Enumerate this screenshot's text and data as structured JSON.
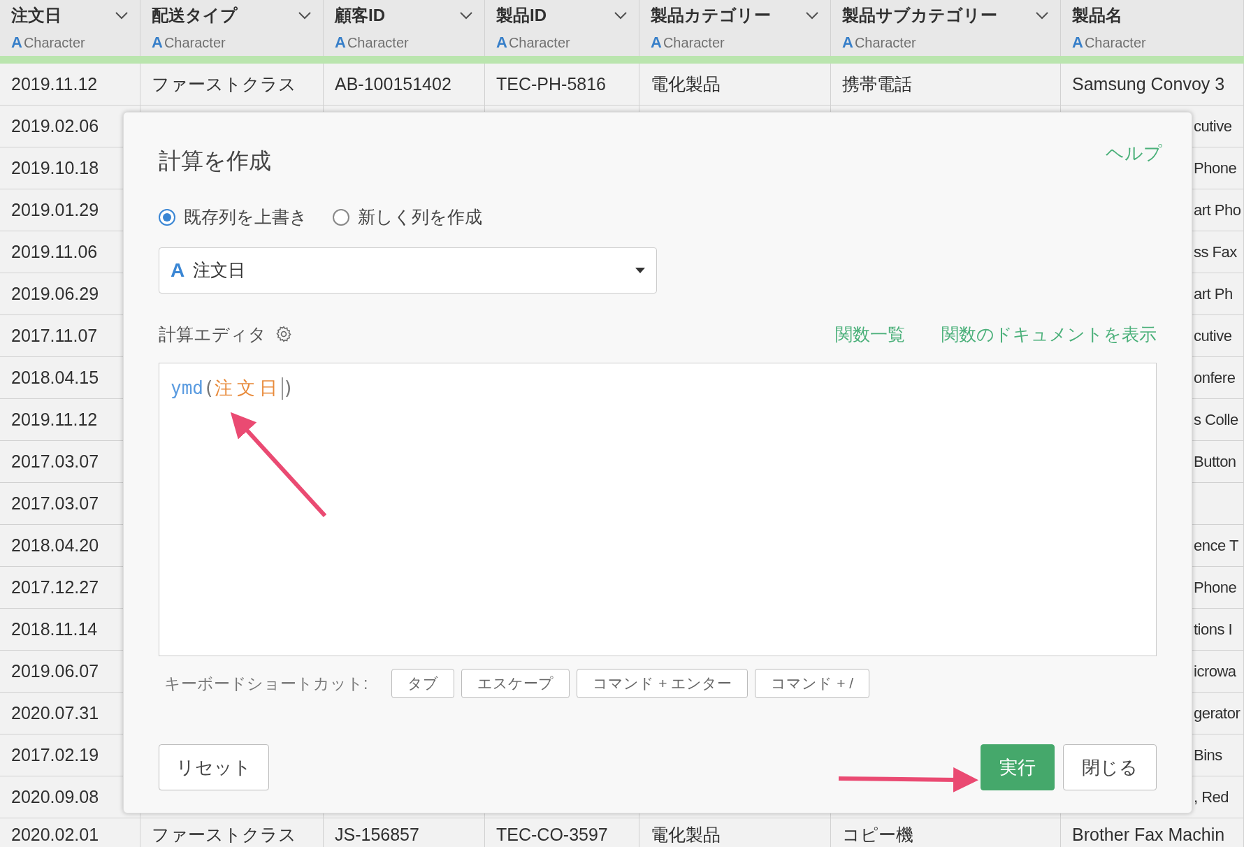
{
  "table": {
    "columns": [
      {
        "name": "注文日",
        "type_icon": "A",
        "type": "Character"
      },
      {
        "name": "配送タイプ",
        "type_icon": "A",
        "type": "Character"
      },
      {
        "name": "顧客ID",
        "type_icon": "A",
        "type": "Character"
      },
      {
        "name": "製品ID",
        "type_icon": "A",
        "type": "Character"
      },
      {
        "name": "製品カテゴリー",
        "type_icon": "A",
        "type": "Character"
      },
      {
        "name": "製品サブカテゴリー",
        "type_icon": "A",
        "type": "Character"
      },
      {
        "name": "製品名",
        "type_icon": "A",
        "type": "Character"
      }
    ],
    "rows": [
      {
        "cells": [
          "2019.11.12",
          "ファーストクラス",
          "AB-100151402",
          "TEC-PH-5816",
          "電化製品",
          "携帯電話",
          "Samsung Convoy 3"
        ]
      },
      {
        "cells": [
          "2019.02.06",
          null,
          null,
          null,
          null,
          null,
          "cutive"
        ]
      },
      {
        "cells": [
          "2019.10.18",
          null,
          null,
          null,
          null,
          null,
          "Phone"
        ]
      },
      {
        "cells": [
          "2019.01.29",
          null,
          null,
          null,
          null,
          null,
          "art Pho"
        ]
      },
      {
        "cells": [
          "2019.11.06",
          null,
          null,
          null,
          null,
          null,
          "ss Fax"
        ]
      },
      {
        "cells": [
          "2019.06.29",
          null,
          null,
          null,
          null,
          null,
          "art Ph"
        ]
      },
      {
        "cells": [
          "2017.11.07",
          null,
          null,
          null,
          null,
          null,
          "cutive"
        ]
      },
      {
        "cells": [
          "2018.04.15",
          null,
          null,
          null,
          null,
          null,
          "onfere"
        ]
      },
      {
        "cells": [
          "2019.11.12",
          null,
          null,
          null,
          null,
          null,
          "s Colle"
        ]
      },
      {
        "cells": [
          "2017.03.07",
          null,
          null,
          null,
          null,
          null,
          "Button"
        ]
      },
      {
        "cells": [
          "2017.03.07",
          null,
          null,
          null,
          null,
          null,
          null
        ]
      },
      {
        "cells": [
          "2018.04.20",
          null,
          null,
          null,
          null,
          null,
          "ence T"
        ]
      },
      {
        "cells": [
          "2017.12.27",
          null,
          null,
          null,
          null,
          null,
          "Phone"
        ]
      },
      {
        "cells": [
          "2018.11.14",
          null,
          null,
          null,
          null,
          null,
          "tions I"
        ]
      },
      {
        "cells": [
          "2019.06.07",
          null,
          null,
          null,
          null,
          null,
          "icrowa"
        ]
      },
      {
        "cells": [
          "2020.07.31",
          null,
          null,
          null,
          null,
          null,
          "gerator"
        ]
      },
      {
        "cells": [
          "2017.02.19",
          null,
          null,
          null,
          null,
          null,
          "Bins"
        ]
      },
      {
        "cells": [
          "2020.09.08",
          null,
          null,
          null,
          null,
          null,
          ", Red"
        ]
      },
      {
        "cells": [
          "2020.02.01",
          "ファーストクラス",
          "JS-156857",
          "TEC-CO-3597",
          "電化製品",
          "コピー機",
          "Brother Fax Machin"
        ]
      }
    ]
  },
  "dialog": {
    "title": "計算を作成",
    "help_link": "ヘルプ",
    "modes": [
      {
        "label": "既存列を上書き",
        "selected": true
      },
      {
        "label": "新しく列を作成",
        "selected": false
      }
    ],
    "column_select": {
      "type_icon": "A",
      "value": "注文日"
    },
    "editor_label": "計算エディタ",
    "links": [
      "関数一覧",
      "関数のドキュメントを表示"
    ],
    "code": [
      {
        "kind": "function",
        "text": "ymd"
      },
      {
        "kind": "punct",
        "text": "("
      },
      {
        "kind": "column",
        "text": "注文日",
        "cursor": true
      },
      {
        "kind": "punct",
        "text": ")"
      }
    ],
    "shortcuts_label": "キーボードショートカット:",
    "shortcuts": [
      "タブ",
      "エスケープ",
      "コマンド + エンター",
      "コマンド + /"
    ],
    "buttons": [
      {
        "label": "リセット",
        "kind": "secondary"
      },
      {
        "label": "実行",
        "kind": "primary"
      },
      {
        "label": "閉じる",
        "kind": "secondary"
      }
    ]
  }
}
